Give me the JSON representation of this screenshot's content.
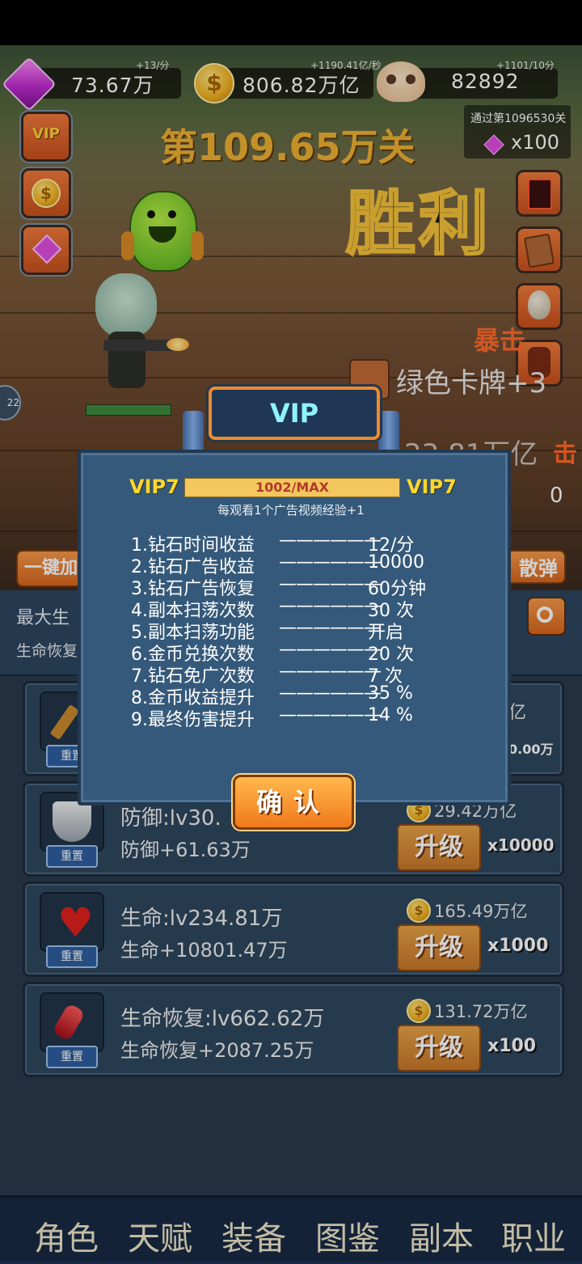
{
  "header": {
    "diamond": {
      "value": "73.67万",
      "rate": "+13/分"
    },
    "gold": {
      "value": "806.82万亿",
      "rate": "+1190.41亿/秒"
    },
    "skull": {
      "value": "82892",
      "rate": "+1101/10分"
    },
    "stage_title": "第109.65万关",
    "cleared_label": "通过第1096530关",
    "cleared_reward": "x100"
  },
  "scene": {
    "victory_text": "胜利",
    "crit_text": "暴击",
    "drop_text": "绿色卡牌+3",
    "drop2_text": "23.81万亿",
    "crit2_text": "击",
    "counter_zero": "0",
    "left_badge": "22",
    "side_vip_label": "VIP",
    "left_button_label": "一键加",
    "right_button_label": "散弹",
    "panel_row1": "最大生",
    "panel_row2": "生命恢复"
  },
  "upgrades": [
    {
      "name": "",
      "bonus": "",
      "cost": "亿",
      "cost_sub": "0.00万",
      "multiplier": "",
      "reset_label": "重置"
    },
    {
      "name": "防御:lv30.",
      "bonus": "防御+61.63万",
      "cost": "29.42万亿",
      "multiplier": "x10000",
      "upgrade_label": "升级",
      "reset_label": "重置"
    },
    {
      "name": "生命:lv234.81万",
      "bonus": "生命+10801.47万",
      "cost": "165.49万亿",
      "multiplier": "x1000",
      "upgrade_label": "升级",
      "reset_label": "重置"
    },
    {
      "name": "生命恢复:lv662.62万",
      "bonus": "生命恢复+2087.25万",
      "cost": "131.72万亿",
      "multiplier": "x100",
      "upgrade_label": "升级",
      "reset_label": "重置"
    }
  ],
  "nav": [
    "角色",
    "天赋",
    "装备",
    "图鉴",
    "副本",
    "职业"
  ],
  "vip_dialog": {
    "title": "VIP",
    "level_left": "VIP7",
    "level_right": "VIP7",
    "exp": "1002/MAX",
    "hint": "每观看1个广告视频经验+1",
    "dash": "——————",
    "perks": [
      {
        "label": "1.钻石时间收益",
        "value": "12/分"
      },
      {
        "label": "2.钻石广告收益",
        "value": "10000"
      },
      {
        "label": "3.钻石广告恢复",
        "value": "60分钟"
      },
      {
        "label": "4.副本扫荡次数",
        "value": "30 次"
      },
      {
        "label": "5.副本扫荡功能",
        "value": "开启"
      },
      {
        "label": "6.金币兑换次数",
        "value": "20 次"
      },
      {
        "label": "7.钻石免广次数",
        "value": "7 次"
      },
      {
        "label": "8.金币收益提升",
        "value": "35 %"
      },
      {
        "label": "9.最终伤害提升",
        "value": "14 %"
      }
    ],
    "confirm_label": "确认"
  },
  "colors": {
    "accent_orange": "#f07a1c",
    "vip_cyan": "#8ff2ff",
    "vip_gold": "#ffd72a",
    "panel_blue": "#35597a"
  }
}
